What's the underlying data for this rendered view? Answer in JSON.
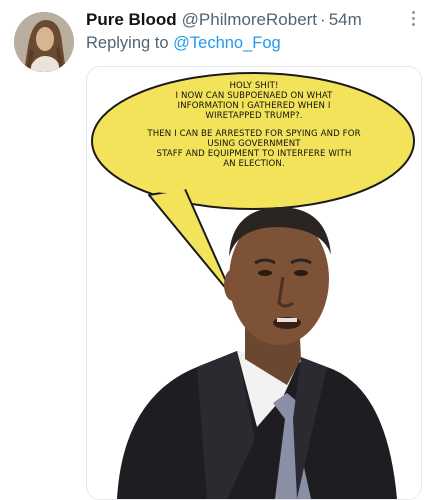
{
  "tweet": {
    "display_name": "Pure Blood",
    "handle": "@PhilmoreRobert",
    "separator": "·",
    "time": "54m",
    "reply_prefix": "Replying to",
    "reply_to": "@Techno_Fog",
    "more_icon": "more-vertical-icon"
  },
  "meme": {
    "bubble_lines_1": [
      "HOLY SHIT!",
      "I NOW CAN SUBPOENAED ON WHAT",
      "INFORMATION I GATHERED WHEN I",
      "WIRETAPPED TRUMP?."
    ],
    "bubble_lines_2": [
      "THEN I CAN BE ARRESTED FOR SPYING AND FOR",
      "USING GOVERNMENT",
      "STAFF AND EQUIPMENT TO INTERFERE WITH",
      "AN ELECTION."
    ],
    "bubble_color": "#f3e35a"
  }
}
